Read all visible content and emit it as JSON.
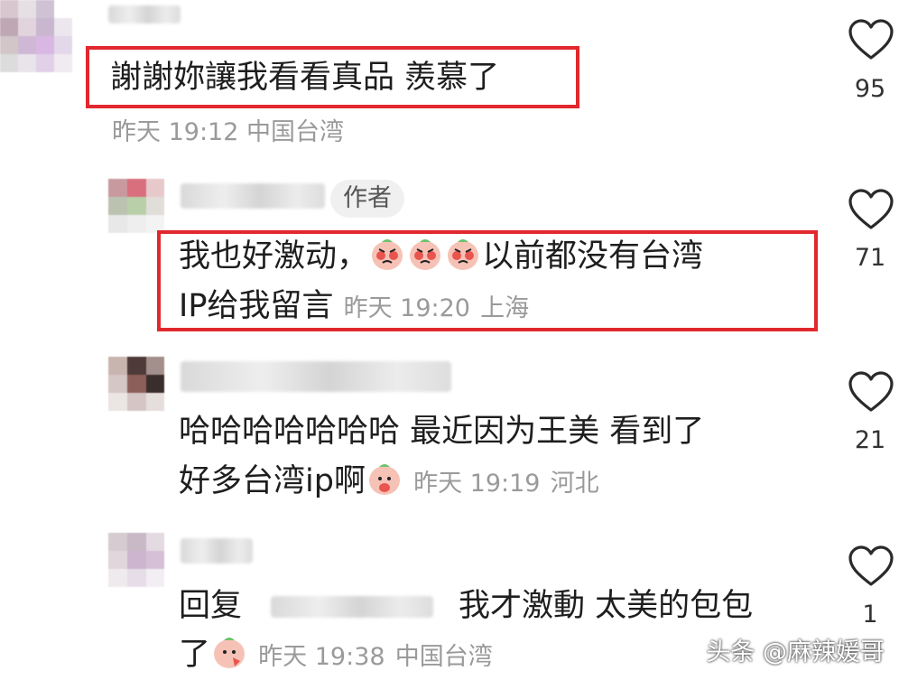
{
  "comments": [
    {
      "text": "謝謝妳讓我看看真品 羨慕了",
      "time": "昨天 19:12",
      "location": "中国台湾",
      "likes": "95"
    },
    {
      "author_badge": "作者",
      "text_a": "我也好激动，",
      "text_b": "以前都没有台湾",
      "text_c": "IP给我留言",
      "time": "昨天 19:20",
      "location": "上海",
      "likes": "71"
    },
    {
      "text_a": "哈哈哈哈哈哈哈 最近因为王美 看到了",
      "text_b": "好多台湾ip啊",
      "time": "昨天 19:19",
      "location": "河北",
      "likes": "21"
    },
    {
      "reply_prefix": "回复",
      "text_a": "我才激動 太美的包包",
      "text_b": "了",
      "time": "昨天 19:38",
      "location": "中国台湾",
      "likes": "1"
    }
  ],
  "watermark": {
    "platform": "头条",
    "handle": "@麻辣媛哥"
  },
  "colors": {
    "highlight_box": "#e0282e",
    "meta_text": "#9a9a9a"
  }
}
